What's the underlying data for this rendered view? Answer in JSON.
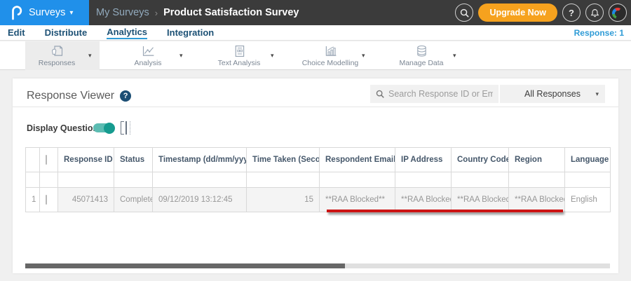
{
  "topbar": {
    "logo_text": "P",
    "product_menu": "Surveys",
    "breadcrumb": {
      "parent": "My Surveys",
      "separator": "›",
      "current": "Product Satisfaction Survey"
    },
    "upgrade_button": "Upgrade Now",
    "help_glyph": "?"
  },
  "nav": {
    "tabs": [
      {
        "label": "Edit",
        "active": false
      },
      {
        "label": "Distribute",
        "active": false
      },
      {
        "label": "Analytics",
        "active": true
      },
      {
        "label": "Integration",
        "active": false
      }
    ],
    "response_count": "Response: 1"
  },
  "toolbar": {
    "active_item": "Responses",
    "items": [
      {
        "label": "Responses",
        "icon": "responses-icon"
      },
      {
        "label": "Analysis",
        "icon": "analysis-icon"
      },
      {
        "label": "Text Analysis",
        "icon": "text-analysis-icon"
      },
      {
        "label": "Choice Modelling",
        "icon": "choice-modelling-icon"
      },
      {
        "label": "Manage Data",
        "icon": "manage-data-icon"
      }
    ]
  },
  "viewer": {
    "title": "Response Viewer",
    "help_glyph": "?",
    "search_placeholder": "Search Response ID or Email",
    "responses_filter": "All Responses",
    "display_questions_label": "Display Questions",
    "display_questions_on": true
  },
  "table": {
    "columns": [
      "Response ID",
      "Status",
      "Timestamp (dd/mm/yyyy)",
      "Time Taken (Seconds)",
      "Respondent Email",
      "IP Address",
      "Country Code",
      "Region",
      "Language"
    ],
    "rows": [
      {
        "index": "1",
        "response_id": "45071413",
        "status": "Completed",
        "timestamp": "09/12/2019 13:12:45",
        "time_taken": "15",
        "respondent_email": "**RAA Blocked**",
        "ip_address": "**RAA Blocked**",
        "country_code": "**RAA Blocked**",
        "region": "**RAA Blocked**",
        "language": "English"
      }
    ]
  },
  "icons": {
    "caret_down": "▾",
    "sort_desc": "▾",
    "sort_both": "⇅"
  },
  "colors": {
    "topbar_bg": "#3b3b3b",
    "brand_blue": "#2090ea",
    "upgrade_orange": "#f6a21e",
    "link_blue": "#2e9bd6",
    "toggle_teal": "#169b8f",
    "annotation_red": "#cc1414",
    "row_gray": "#f4f4f4",
    "response_id_blue": "#5b8db8"
  }
}
